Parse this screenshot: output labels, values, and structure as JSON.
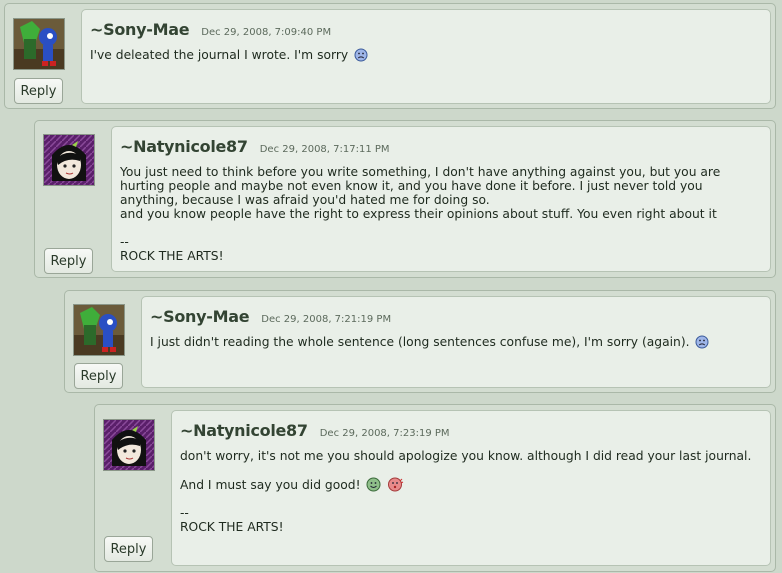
{
  "comments": [
    {
      "author": "~Sony-Mae",
      "date": "Dec 29, 2008, 7:09:40 PM",
      "reply_label": "Reply",
      "text": "I've deleated the journal I wrote. I'm sorry",
      "emoticon": "sad-face-icon"
    },
    {
      "author": "~Natynicole87",
      "date": "Dec 29, 2008, 7:17:11 PM",
      "reply_label": "Reply",
      "line1": "You just need to think before you write something, I don't have anything against you, but you are hurting people and maybe not even know it, and you have done it before. I just never told you anything, because I was afraid you'd hated me for doing so.",
      "line2": "and you know people have the right to express their opinions about stuff. You even right about it",
      "sig_sep": "--",
      "signature": "ROCK THE ARTS!"
    },
    {
      "author": "~Sony-Mae",
      "date": "Dec 29, 2008, 7:21:19 PM",
      "reply_label": "Reply",
      "text": "I just didn't reading the whole sentence (long sentences confuse me), I'm sorry (again).",
      "emoticon": "sad-face-icon"
    },
    {
      "author": "~Natynicole87",
      "date": "Dec 29, 2008, 7:23:19 PM",
      "reply_label": "Reply",
      "line1": "don't worry, it's not me you should apologize you know. although I did read your last journal.",
      "line2": "And I must say you did good!",
      "emoticons": [
        "green-smile-icon",
        "red-kiss-icon"
      ],
      "sig_sep": "--",
      "signature": "ROCK THE ARTS!"
    }
  ],
  "colors": {
    "page_bg": "#cdd8cb",
    "bubble_bg": "#e9efe8",
    "author": "#334433"
  }
}
